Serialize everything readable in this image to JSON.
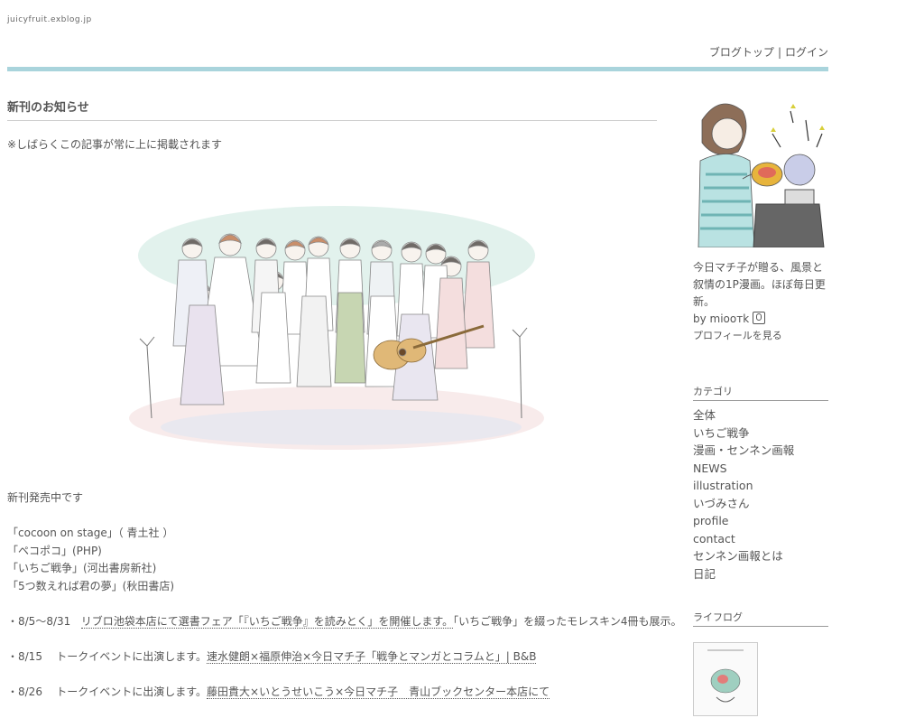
{
  "site": {
    "url": "juicyfruit.exblog.jp"
  },
  "nav": {
    "blog_top": "ブログトップ",
    "separator": "|",
    "login": "ログイン"
  },
  "post": {
    "title": "新刊のお知らせ",
    "notice": "※しばらくこの記事が常に上に掲載されます",
    "intro": "新刊発売中です",
    "books": [
      "「cocoon on stage」（ 青土社 ）",
      "「ペコポコ」(PHP)",
      "「いちご戦争」(河出書房新社)",
      "「5つ数えれば君の夢」(秋田書店)"
    ],
    "events": [
      {
        "date": "・8/5〜8/31",
        "link": "リブロ池袋本店にて選書フェア「『いちご戦争』を読みとく」を開催します。",
        "rest": "「いちご戦争」を綴ったモレスキン4冊も展示。"
      },
      {
        "date": "・8/15",
        "pre": "トークイベントに出演します。",
        "link": "速水健朗×福原伸治×今日マチ子「戦争とマンガとコラムと」| B&B"
      },
      {
        "date": "・8/26",
        "pre": "トークイベントに出演します。",
        "link": "藤田貴大×いとうせいこう×今日マチ子　青山ブックセンター本店にて"
      }
    ]
  },
  "sidebar": {
    "bio": "今日マチ子が贈る、風景と叙情の1P漫画。ほぼ毎日更新。",
    "by_label": "by mioотk",
    "profile_link": "プロフィールを見る",
    "category_title": "カテゴリ",
    "categories": [
      "全体",
      "いちご戦争",
      "漫画・センネン画報",
      "NEWS",
      "illustration",
      "いづみさん",
      "profile",
      "contact",
      "センネン画報とは",
      "日記"
    ],
    "lifelog_title": "ライフログ"
  },
  "colors": {
    "header_bar": "#a9d4dc",
    "text": "#555555"
  },
  "icons": {
    "mic": "mic-icon"
  }
}
